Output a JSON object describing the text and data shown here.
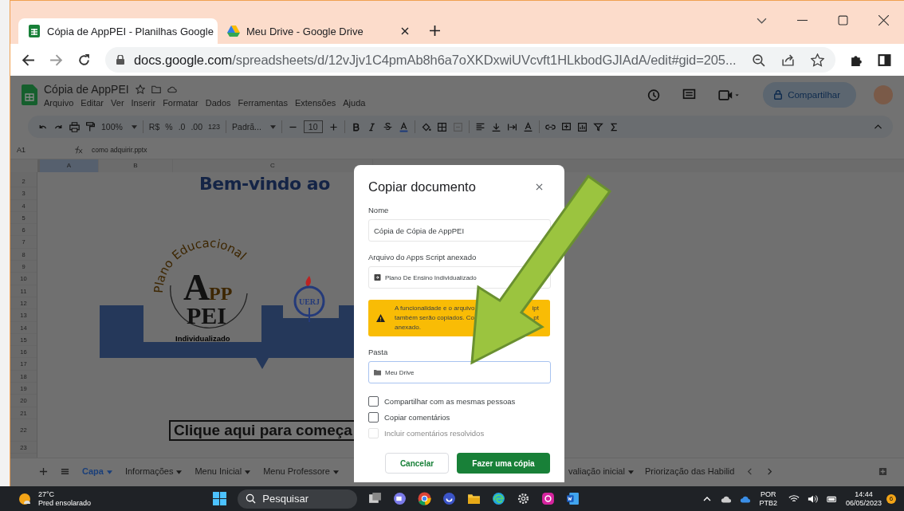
{
  "browser": {
    "tabs": [
      {
        "title": "Cópia de AppPEI - Planilhas Google",
        "selected": true
      },
      {
        "title": "Meu Drive - Google Drive",
        "selected": false
      }
    ],
    "url": {
      "host": "docs.google.com",
      "path": "/spreadsheets/d/12vJjv1C4pmAb8h6a7oXKDxwiUVcvft1HLkbodGJIAdA/edit#gid=205..."
    }
  },
  "sheets": {
    "title": "Cópia de AppPEI",
    "menu": [
      "Arquivo",
      "Editar",
      "Ver",
      "Inserir",
      "Formatar",
      "Dados",
      "Ferramentas",
      "Extensões",
      "Ajuda"
    ],
    "share": "Compartilhar",
    "toolbar": {
      "zoom": "100%",
      "currency": "R$",
      "percent": "%",
      "decrease_decimals": ".0",
      "increase_decimals": ".00",
      "number_format": "123",
      "font": "Padrã...",
      "font_size": "10"
    },
    "formula_bar": {
      "cell": "A1",
      "content": "como adquirir.pptx"
    },
    "columns": [
      "A",
      "B",
      "C"
    ],
    "rows": [
      "2",
      "3",
      "4",
      "5",
      "6",
      "7",
      "8",
      "9",
      "10",
      "11",
      "12",
      "13",
      "14",
      "15",
      "16",
      "17",
      "18",
      "19",
      "20",
      "21",
      "22",
      "23"
    ],
    "canvas": {
      "heading": "Bem-vindo ao",
      "logo_arc": "Plano Educacional",
      "logo_a": "A",
      "logo_pp": "PP",
      "logo_pei": "PEI",
      "logo_caption": "Individualizado",
      "emblem": "UERJ",
      "start_button": "Clique aqui para começa"
    },
    "sheet_tabs": [
      {
        "label": "Capa",
        "selected": true
      },
      {
        "label": "Informações",
        "selected": false
      },
      {
        "label": "Menu Inicial",
        "selected": false
      },
      {
        "label": "Menu Professore",
        "selected": false
      },
      {
        "label": "valiação inicial",
        "selected": false
      },
      {
        "label": "Priorização das Habilid",
        "selected": false
      }
    ]
  },
  "dialog": {
    "title": "Copiar documento",
    "name_label": "Nome",
    "name_value": "Cópia de Cópia de AppPEI",
    "script_label": "Arquivo do Apps Script anexado",
    "script_value": "Plano De Ensino Individualizado",
    "warning_lines": [
      "A funcionalidade e o arquivo",
      "também serão copiados. Co",
      "anexado."
    ],
    "warning_lines_right": [
      "ipt",
      "pt"
    ],
    "folder_label": "Pasta",
    "folder_value": "Meu Drive",
    "options": [
      {
        "label": "Compartilhar com as mesmas pessoas",
        "checked": false,
        "disabled": false
      },
      {
        "label": "Copiar comentários",
        "checked": false,
        "disabled": false
      },
      {
        "label": "Incluir comentários resolvidos",
        "checked": false,
        "disabled": true
      }
    ],
    "cancel": "Cancelar",
    "confirm": "Fazer uma cópia"
  },
  "taskbar": {
    "temperature": "27°C",
    "weather": "Pred ensolarado",
    "search": "Pesquisar",
    "language": "POR",
    "layout": "PTB2",
    "time": "14:44",
    "date": "06/05/2023",
    "notifications": "6"
  }
}
